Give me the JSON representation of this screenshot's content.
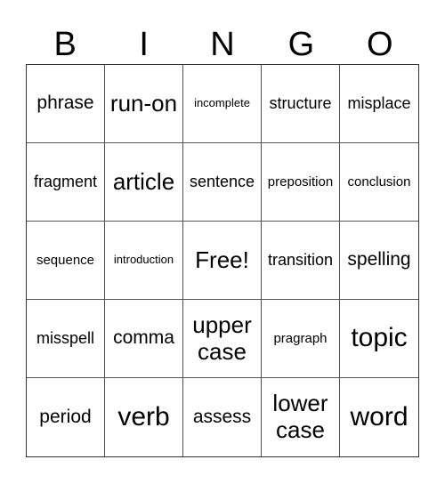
{
  "header": [
    "B",
    "I",
    "N",
    "G",
    "O"
  ],
  "cells": [
    {
      "text": "phrase",
      "size": "l"
    },
    {
      "text": "run-on",
      "size": "xl"
    },
    {
      "text": "incomplete",
      "size": "xs"
    },
    {
      "text": "structure",
      "size": "m"
    },
    {
      "text": "misplace",
      "size": "m"
    },
    {
      "text": "fragment",
      "size": "m"
    },
    {
      "text": "article",
      "size": "xl"
    },
    {
      "text": "sentence",
      "size": "m"
    },
    {
      "text": "preposition",
      "size": "s"
    },
    {
      "text": "conclusion",
      "size": "s"
    },
    {
      "text": "sequence",
      "size": "s"
    },
    {
      "text": "introduction",
      "size": "xs"
    },
    {
      "text": "Free!",
      "size": "xl"
    },
    {
      "text": "transition",
      "size": "m"
    },
    {
      "text": "spelling",
      "size": "l"
    },
    {
      "text": "misspell",
      "size": "m"
    },
    {
      "text": "comma",
      "size": "l"
    },
    {
      "text": "upper case",
      "size": "xl"
    },
    {
      "text": "pragraph",
      "size": "s"
    },
    {
      "text": "topic",
      "size": "xxl"
    },
    {
      "text": "period",
      "size": "l"
    },
    {
      "text": "verb",
      "size": "xxl"
    },
    {
      "text": "assess",
      "size": "l"
    },
    {
      "text": "lower case",
      "size": "xl"
    },
    {
      "text": "word",
      "size": "xxl"
    }
  ]
}
